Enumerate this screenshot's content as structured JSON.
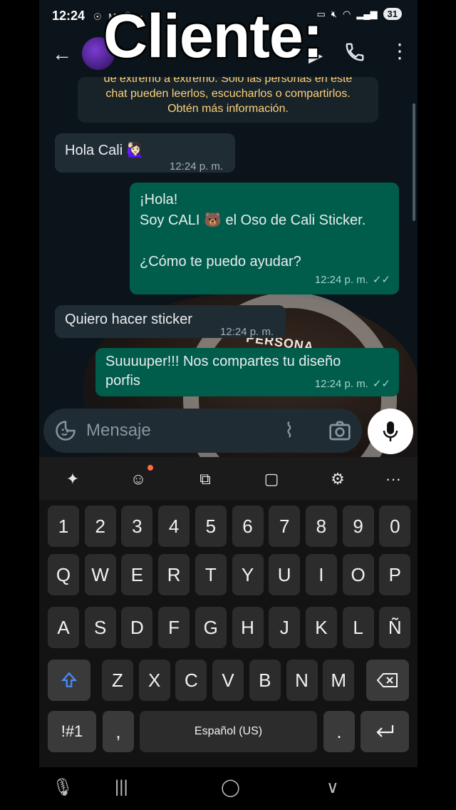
{
  "overlay_title": "Cliente:",
  "status_bar": {
    "time": "12:24",
    "notification_icons": "☉ M ⓪ •",
    "battery": "31"
  },
  "encryption_notice": {
    "line1": "de extremo a extremo. Solo las personas en este",
    "line2": "chat pueden leerlos, escucharlos o compartirlos.",
    "line3": "Obtén más información."
  },
  "messages": [
    {
      "direction": "in",
      "lines": [
        "Hola Cali 🙋🏻‍♀️"
      ],
      "time": "12:24 p. m."
    },
    {
      "direction": "out",
      "lines": [
        "¡Hola!",
        "Soy CALI 🐻 el Oso de Cali Sticker.",
        "",
        "¿Cómo te puedo ayudar?"
      ],
      "time": "12:24 p. m.",
      "ticks": "✓✓"
    },
    {
      "direction": "in",
      "lines": [
        "Quiero hacer sticker"
      ],
      "time": "12:24 p. m."
    },
    {
      "direction": "out",
      "lines": [
        "Suuuuper!!! Nos compartes tu diseño",
        "porfis"
      ],
      "time": "12:24 p. m.",
      "ticks": "✓✓"
    }
  ],
  "sticker_label": "PERSONA",
  "input": {
    "placeholder": "Mensaje"
  },
  "keyboard": {
    "row_numbers": [
      "1",
      "2",
      "3",
      "4",
      "5",
      "6",
      "7",
      "8",
      "9",
      "0"
    ],
    "row_q": [
      "Q",
      "W",
      "E",
      "R",
      "T",
      "Y",
      "U",
      "I",
      "O",
      "P"
    ],
    "row_a": [
      "A",
      "S",
      "D",
      "F",
      "G",
      "H",
      "J",
      "K",
      "L",
      "Ñ"
    ],
    "row_z": [
      "Z",
      "X",
      "C",
      "V",
      "B",
      "N",
      "M"
    ],
    "symbols_key": "!#1",
    "comma_key": ",",
    "space_label": "Español (US)",
    "period_key": ".",
    "toolbar_more": "···"
  },
  "colors": {
    "incoming_bubble": "#202c33",
    "outgoing_bubble": "#005c4b",
    "notice_text": "#ffd279",
    "background": "#0b141a"
  }
}
